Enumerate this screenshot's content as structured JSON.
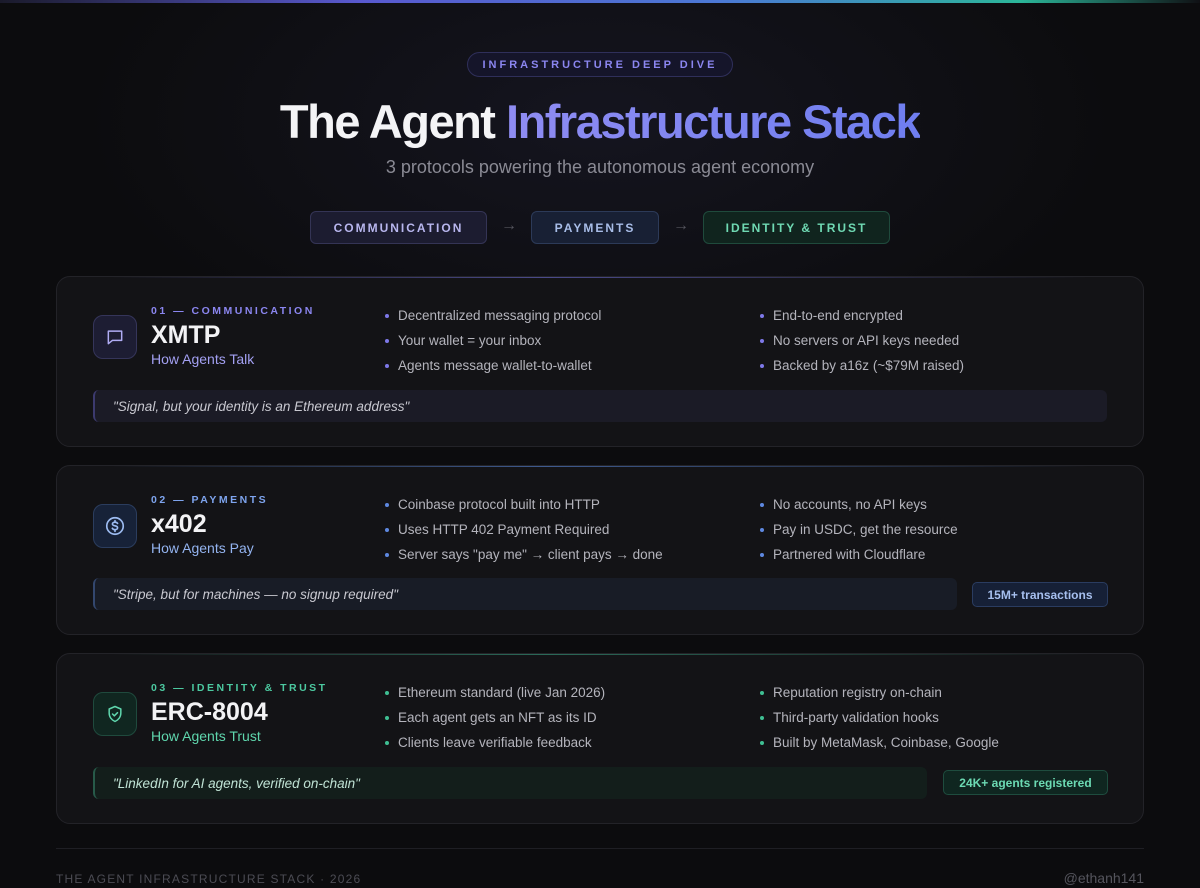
{
  "header": {
    "kicker": "INFRASTRUCTURE DEEP DIVE",
    "title_plain": "The Agent ",
    "title_accent": "Infrastructure Stack",
    "subtitle": "3 protocols powering the autonomous agent economy"
  },
  "flow": {
    "steps": [
      "COMMUNICATION",
      "PAYMENTS",
      "IDENTITY & TRUST"
    ],
    "arrow": "→"
  },
  "cards": [
    {
      "number": "01 — COMMUNICATION",
      "name": "XMTP",
      "tagline": "How Agents Talk",
      "icon": "chat-bubble-icon",
      "bullets_left": [
        "Decentralized messaging protocol",
        "Your wallet = your inbox",
        "Agents message wallet-to-wallet"
      ],
      "bullets_right": [
        "End-to-end encrypted",
        "No servers or API keys needed",
        "Backed by a16z (~$79M raised)"
      ],
      "quote": "\"Signal, but your identity is an Ethereum address\""
    },
    {
      "number": "02 — PAYMENTS",
      "name": "x402",
      "tagline": "How Agents Pay",
      "icon": "dollar-coin-icon",
      "bullets_left": [
        "Coinbase protocol built into HTTP",
        "Uses HTTP 402 Payment Required",
        "Server says \"pay me\" → client pays → done"
      ],
      "bullets_right": [
        "No accounts, no API keys",
        "Pay in USDC, get the resource",
        "Partnered with Cloudflare"
      ],
      "quote": "\"Stripe, but for machines — no signup required\"",
      "stat": "15M+ transactions"
    },
    {
      "number": "03 — IDENTITY & TRUST",
      "name": "ERC-8004",
      "tagline": "How Agents Trust",
      "icon": "shield-check-icon",
      "bullets_left": [
        "Ethereum standard (live Jan 2026)",
        "Each agent gets an NFT as its ID",
        "Clients leave verifiable feedback"
      ],
      "bullets_right": [
        "Reputation registry on-chain",
        "Third-party validation hooks",
        "Built by MetaMask, Coinbase, Google"
      ],
      "quote": "\"LinkedIn for AI agents, verified on-chain\"",
      "stat": "24K+ agents registered"
    }
  ],
  "footer": {
    "left": "THE AGENT INFRASTRUCTURE STACK · 2026",
    "right": "@ethanh141"
  },
  "colors": {
    "background": "#0c0c0e",
    "communication_accent": "#8b86f0",
    "payments_accent": "#7ea4ee",
    "trust_accent": "#4cc9a0"
  }
}
